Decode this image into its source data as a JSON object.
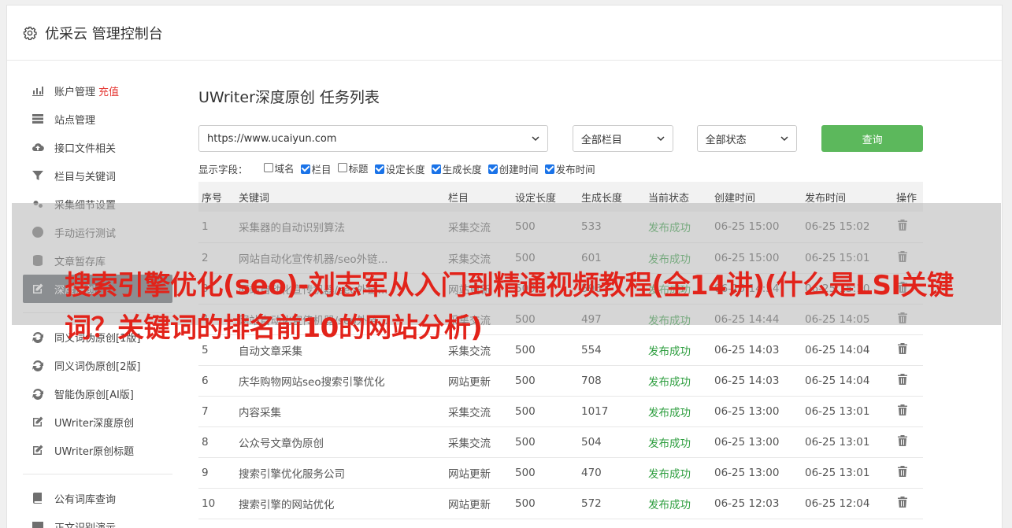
{
  "app": {
    "title": "优采云 管理控制台",
    "icon": "gear-icon"
  },
  "sidebar": {
    "items": [
      {
        "label": "账户管理",
        "badge": "充值",
        "icon": "bar-chart-icon"
      },
      {
        "label": "站点管理",
        "icon": "server-icon"
      },
      {
        "label": "接口文件相关",
        "icon": "cloud-upload-icon"
      },
      {
        "label": "栏目与关键词",
        "icon": "filter-icon"
      },
      {
        "label": "采集细节设置",
        "icon": "gears-icon"
      },
      {
        "label": "手动运行测试",
        "icon": "play-circle-icon"
      },
      {
        "label": "文章暂存库",
        "icon": "database-icon"
      },
      {
        "label": "深度原创",
        "icon": "edit-icon",
        "active": true
      }
    ],
    "items2": [
      {
        "label": "同义词伪原创[1版]",
        "icon": "refresh-icon"
      },
      {
        "label": "同义词伪原创[2版]",
        "icon": "refresh-icon"
      },
      {
        "label": "智能伪原创[AI版]",
        "icon": "refresh-icon"
      },
      {
        "label": "UWriter深度原创",
        "icon": "edit-icon"
      },
      {
        "label": "UWriter原创标题",
        "icon": "edit-icon"
      }
    ],
    "items3": [
      {
        "label": "公有词库查询",
        "icon": "book-icon"
      },
      {
        "label": "正文识别演示",
        "icon": "monitor-icon"
      }
    ]
  },
  "main": {
    "title": "UWriter深度原创 任务列表",
    "filters": {
      "site": "https://www.ucaiyun.com",
      "column": "全部栏目",
      "status": "全部状态",
      "query_label": "查询"
    },
    "fields": {
      "label": "显示字段：",
      "items": [
        {
          "label": "域名",
          "checked": false
        },
        {
          "label": "栏目",
          "checked": true
        },
        {
          "label": "标题",
          "checked": false
        },
        {
          "label": "设定长度",
          "checked": true
        },
        {
          "label": "生成长度",
          "checked": true
        },
        {
          "label": "创建时间",
          "checked": true
        },
        {
          "label": "发布时间",
          "checked": true
        }
      ]
    },
    "table": {
      "headers": [
        "序号",
        "关键词",
        "栏目",
        "设定长度",
        "生成长度",
        "当前状态",
        "创建时间",
        "发布时间",
        "操作"
      ],
      "rows": [
        [
          "1",
          "采集器的自动识别算法",
          "采集交流",
          "500",
          "533",
          "发布成功",
          "06-25 15:00",
          "06-25 15:02"
        ],
        [
          "2",
          "网站自动化宣传机器/seo外链...",
          "采集交流",
          "500",
          "601",
          "发布成功",
          "06-25 15:00",
          "06-25 15:01"
        ],
        [
          "3",
          "网站自动化宣传机器/seo外链...",
          "网站更新",
          "500",
          "596",
          "发布成功",
          "06-25 14:54",
          "06-25 15:10"
        ],
        [
          "4",
          "网站自动化宣传机器/seo外链...",
          "采集交流",
          "500",
          "497",
          "发布成功",
          "06-25 14:44",
          "06-25 14:05"
        ],
        [
          "5",
          "自动文章采集",
          "采集交流",
          "500",
          "554",
          "发布成功",
          "06-25 14:03",
          "06-25 14:04"
        ],
        [
          "6",
          "庆华购物网站seo搜索引擎优化",
          "网站更新",
          "500",
          "708",
          "发布成功",
          "06-25 14:03",
          "06-25 14:04"
        ],
        [
          "7",
          "内容采集",
          "采集交流",
          "500",
          "1017",
          "发布成功",
          "06-25 13:00",
          "06-25 13:01"
        ],
        [
          "8",
          "公众号文章伪原创",
          "采集交流",
          "500",
          "504",
          "发布成功",
          "06-25 13:00",
          "06-25 13:01"
        ],
        [
          "9",
          "搜索引擎优化服务公司",
          "网站更新",
          "500",
          "470",
          "发布成功",
          "06-25 13:00",
          "06-25 13:01"
        ],
        [
          "10",
          "搜索引擎的网站优化",
          "网站更新",
          "500",
          "572",
          "发布成功",
          "06-25 12:03",
          "06-25 12:04"
        ]
      ]
    }
  },
  "overlay": {
    "headline": "搜索引擎优化(seo)-刘志军从入门到精通视频教程(全14讲)(什么是LSI关键词？关键词的排名前10的网站分析)"
  },
  "colors": {
    "accent_green": "#5cb85c",
    "status_green": "#2e9e3f",
    "headline_red": "#e2231a",
    "recharge_red": "#e53935",
    "active_nav": "#5a5f66"
  }
}
